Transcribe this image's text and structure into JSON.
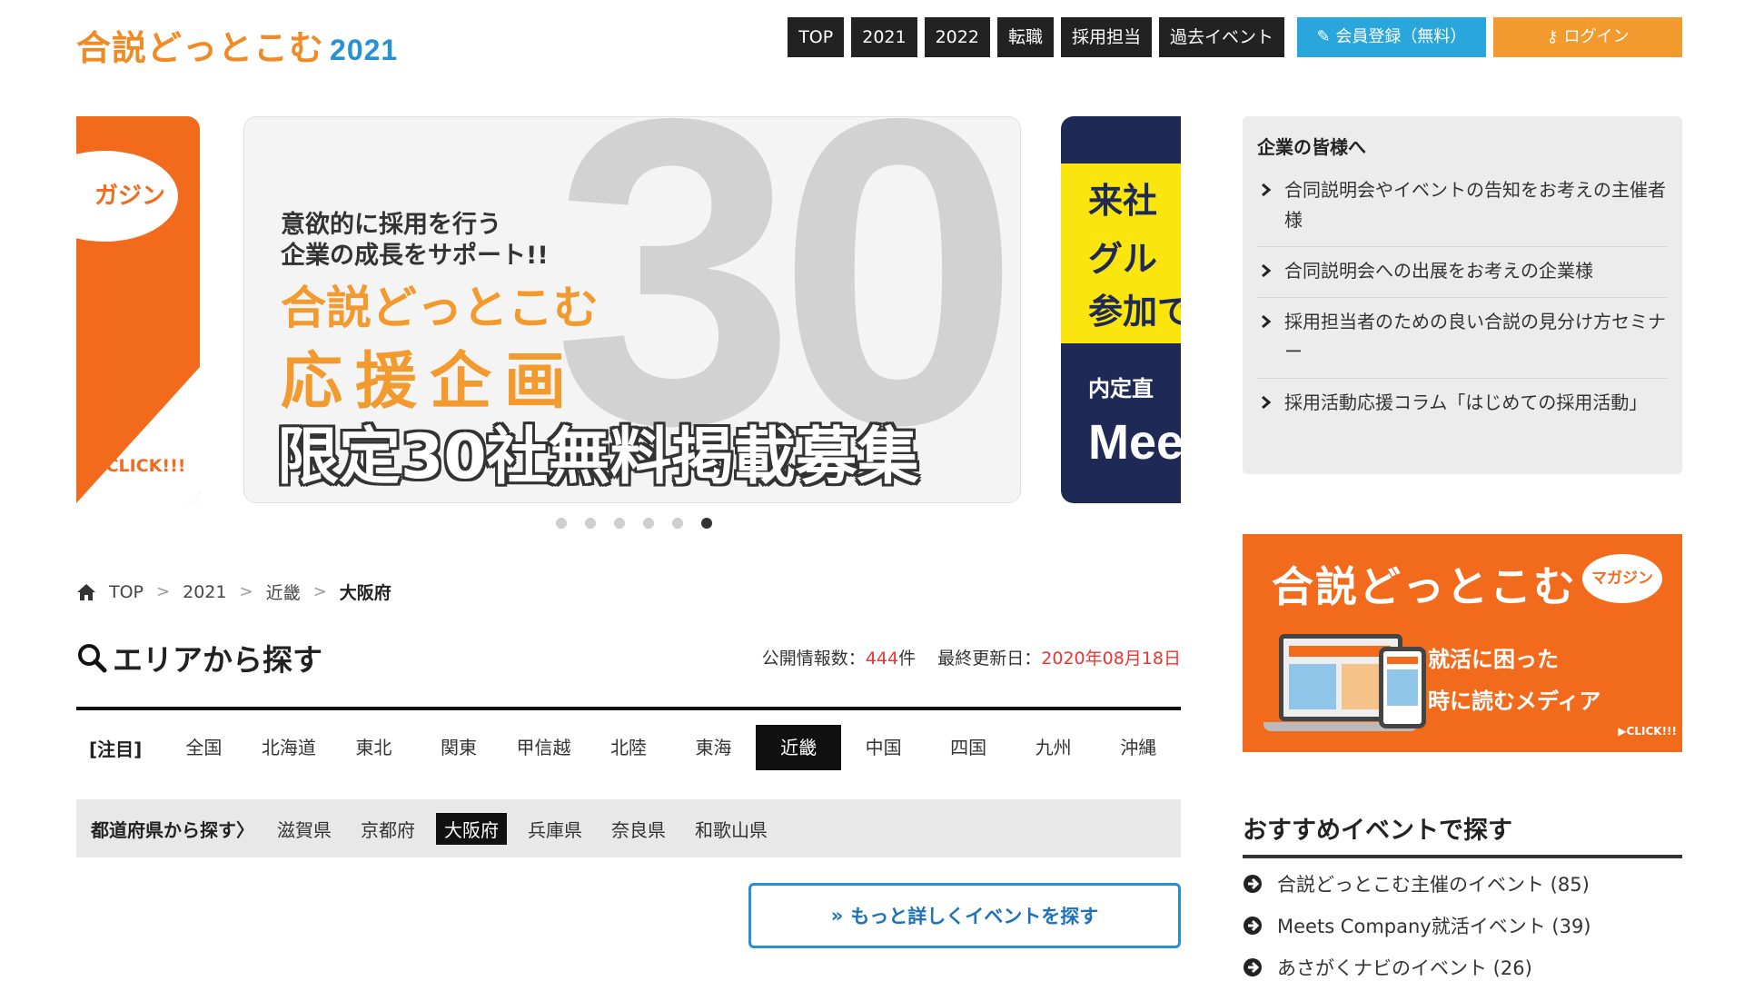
{
  "header": {
    "logo_main": "合説どっとこむ",
    "logo_year": "2021",
    "nav": [
      "TOP",
      "2021",
      "2022",
      "転職",
      "採用担当",
      "過去イベント"
    ],
    "register": "会員登録（無料）",
    "login": "ログイン"
  },
  "carousel": {
    "left_badge": "ガジン",
    "left_click": "▶CLICK!!!",
    "main": {
      "bg_number": "30",
      "line1": "意欲的に採用を行う",
      "line2": "企業の成長をサポート!!",
      "line3": "合説どっとこむ",
      "line4": "応援企画",
      "line5": "限定30社無料掲載募集"
    },
    "right": {
      "y1": "来社",
      "y2": "グル",
      "y3": "参加で",
      "w1": "内定直",
      "w2": "Mee"
    },
    "slide_count": 6,
    "active_slide": 6
  },
  "breadcrumb": [
    "TOP",
    "2021",
    "近畿",
    "大阪府"
  ],
  "area": {
    "title": "エリアから探す",
    "count_label": "公開情報数：",
    "count_value": "444",
    "count_unit": "件",
    "updated_label": "最終更新日：",
    "updated_value": "2020年08月18日",
    "regions_label": "[注目]",
    "regions": [
      "全国",
      "北海道",
      "東北",
      "関東",
      "甲信越",
      "北陸",
      "東海",
      "近畿",
      "中国",
      "四国",
      "九州",
      "沖縄"
    ],
    "active_region": "近畿",
    "prefs_label": "都道府県から探す〉",
    "prefs": [
      "滋賀県",
      "京都府",
      "大阪府",
      "兵庫県",
      "奈良県",
      "和歌山県"
    ],
    "active_pref": "大阪府",
    "more_button": "もっと詳しくイベントを探す"
  },
  "sidebar": {
    "corp_title": "企業の皆様へ",
    "corp_items": [
      "合同説明会やイベントの告知をお考えの主催者様",
      "合同説明会への出展をお考えの企業様",
      "採用担当者のための良い合説の見分け方セミナー",
      "採用活動応援コラム「はじめての採用活動」"
    ],
    "magazine": {
      "title": "合説どっとこむ",
      "pill": "マガジン",
      "line1": "就活に困った",
      "line2": "時に読むメディア",
      "click": "▶CLICK!!!"
    },
    "rec_title": "おすすめイベントで探す",
    "rec_items": [
      "合説どっとこむ主催のイベント (85)",
      "Meets Company就活イベント (39)",
      "あさがくナビのイベント (26)"
    ]
  }
}
